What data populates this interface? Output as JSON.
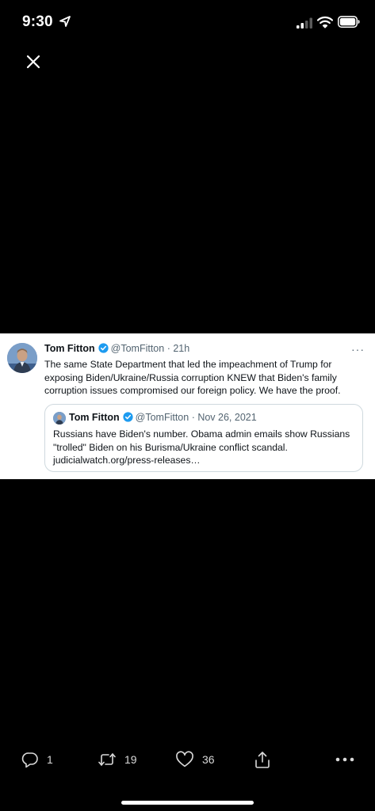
{
  "status_bar": {
    "time": "9:30"
  },
  "tweet": {
    "name": "Tom Fitton",
    "handle": "@TomFitton",
    "separator": " · ",
    "age": "21h",
    "more": "···",
    "text": "The same State Department that led the impeachment of Trump for\nexposing Biden/Ukraine/Russia corruption KNEW that Biden's family\ncorruption issues compromised our foreign policy. We have the proof."
  },
  "quoted_tweet": {
    "name": "Tom Fitton",
    "handle": "@TomFitton",
    "separator": " · ",
    "date": "Nov 26, 2021",
    "text": "Russians have Biden's number. Obama admin emails show Russians\n\"trolled\" Biden on his Burisma/Ukraine conflict scandal.\njudicialwatch.org/press-releases…"
  },
  "actions": {
    "replies": "1",
    "retweets": "19",
    "likes": "36"
  },
  "colors": {
    "background": "#000000",
    "card": "#ffffff",
    "verified": "#1d9bf0",
    "muted_text": "#536471"
  }
}
